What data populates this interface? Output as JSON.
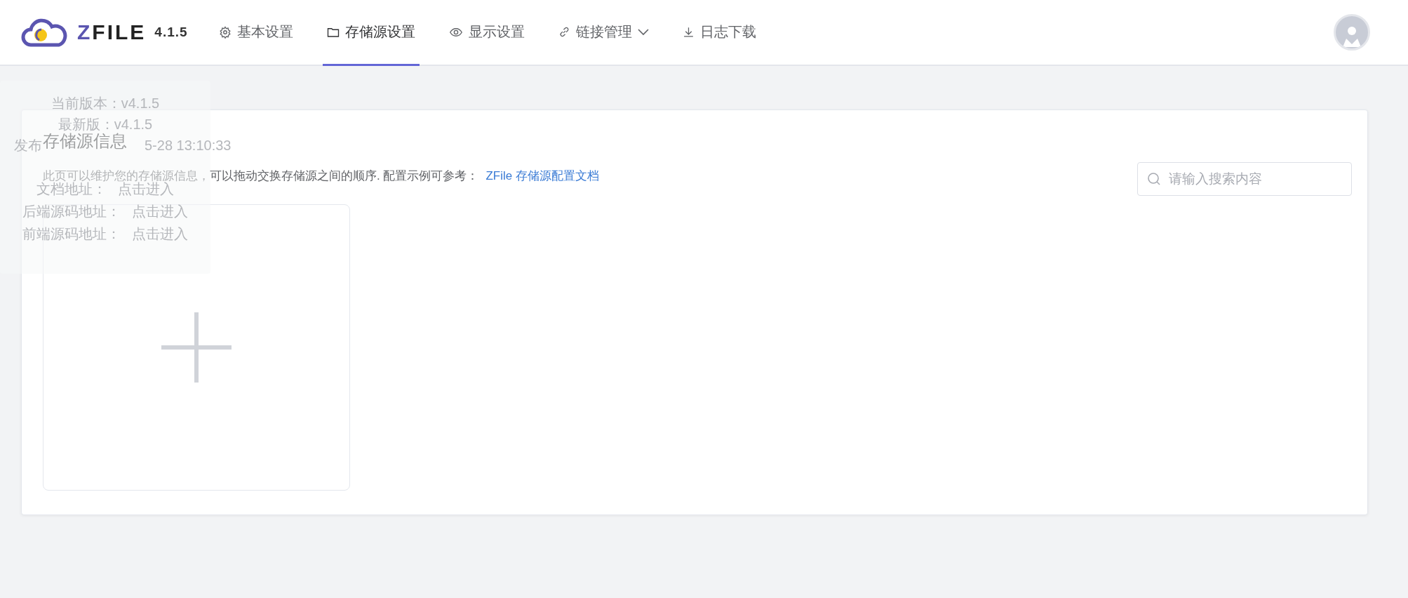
{
  "header": {
    "logo": {
      "name": "ZFILE",
      "version": "4.1.5"
    },
    "nav": [
      {
        "label": "基本设置",
        "kind": "gear",
        "selected": false,
        "dropdown": false
      },
      {
        "label": "存储源设置",
        "kind": "folder",
        "selected": true,
        "dropdown": false
      },
      {
        "label": "显示设置",
        "kind": "eye",
        "selected": false,
        "dropdown": false
      },
      {
        "label": "链接管理",
        "kind": "link",
        "selected": false,
        "dropdown": true
      },
      {
        "label": "日志下载",
        "kind": "download",
        "selected": false,
        "dropdown": false
      }
    ]
  },
  "version_popover": {
    "current_version": "当前版本：v4.1.5",
    "latest_version": "最新版：v4.1.5",
    "release_label": "发布",
    "release_time": "5-28 13:10:33",
    "links": [
      {
        "label": "文档地址：",
        "action": "点击进入"
      },
      {
        "label": "后端源码地址：",
        "action": "点击进入"
      },
      {
        "label": "前端源码地址：",
        "action": "点击进入"
      }
    ]
  },
  "storage_card": {
    "title": "存储源信息",
    "description": "此页可以维护您的存储源信息，可以拖动交换存储源之间的顺序. 配置示例可参考：",
    "doc_link": "ZFile 存储源配置文档",
    "search": {
      "placeholder": "请输入搜索内容"
    }
  }
}
